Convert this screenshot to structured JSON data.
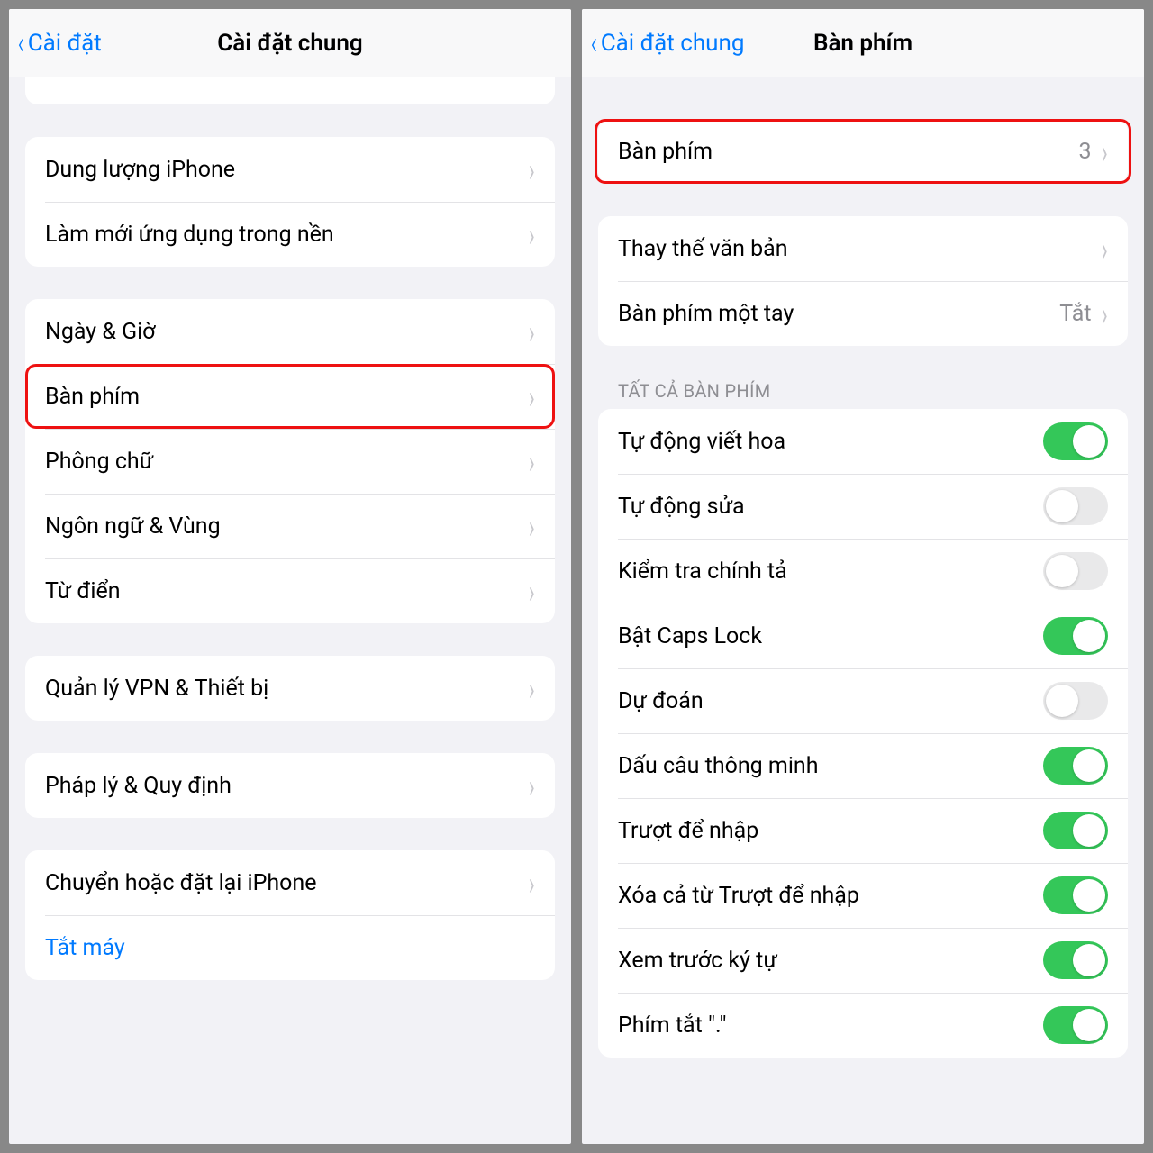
{
  "left": {
    "back": "Cài đặt",
    "title": "Cài đặt chung",
    "group1": [
      {
        "label": "Dung lượng iPhone"
      },
      {
        "label": "Làm mới ứng dụng trong nền"
      }
    ],
    "group2": [
      {
        "label": "Ngày & Giờ"
      },
      {
        "label": "Bàn phím",
        "highlight": true
      },
      {
        "label": "Phông chữ"
      },
      {
        "label": "Ngôn ngữ & Vùng"
      },
      {
        "label": "Từ điển"
      }
    ],
    "group3": [
      {
        "label": "Quản lý VPN & Thiết bị"
      }
    ],
    "group4": [
      {
        "label": "Pháp lý & Quy định"
      }
    ],
    "group5": [
      {
        "label": "Chuyển hoặc đặt lại iPhone"
      },
      {
        "label": "Tắt máy",
        "link": true,
        "no_chevron": true
      }
    ]
  },
  "right": {
    "back": "Cài đặt chung",
    "title": "Bàn phím",
    "top": {
      "label": "Bàn phím",
      "value": "3"
    },
    "group2": [
      {
        "label": "Thay thế văn bản"
      },
      {
        "label": "Bàn phím một tay",
        "value": "Tắt"
      }
    ],
    "section_header": "TẤT CẢ BÀN PHÍM",
    "toggles": [
      {
        "label": "Tự động viết hoa",
        "on": true
      },
      {
        "label": "Tự động sửa",
        "on": false
      },
      {
        "label": "Kiểm tra chính tả",
        "on": false
      },
      {
        "label": "Bật Caps Lock",
        "on": true
      },
      {
        "label": "Dự đoán",
        "on": false
      },
      {
        "label": "Dấu câu thông minh",
        "on": true
      },
      {
        "label": "Trượt để nhập",
        "on": true
      },
      {
        "label": "Xóa cả từ Trượt để nhập",
        "on": true
      },
      {
        "label": "Xem trước ký tự",
        "on": true
      },
      {
        "label": "Phím tắt \".\"",
        "on": true
      }
    ]
  }
}
